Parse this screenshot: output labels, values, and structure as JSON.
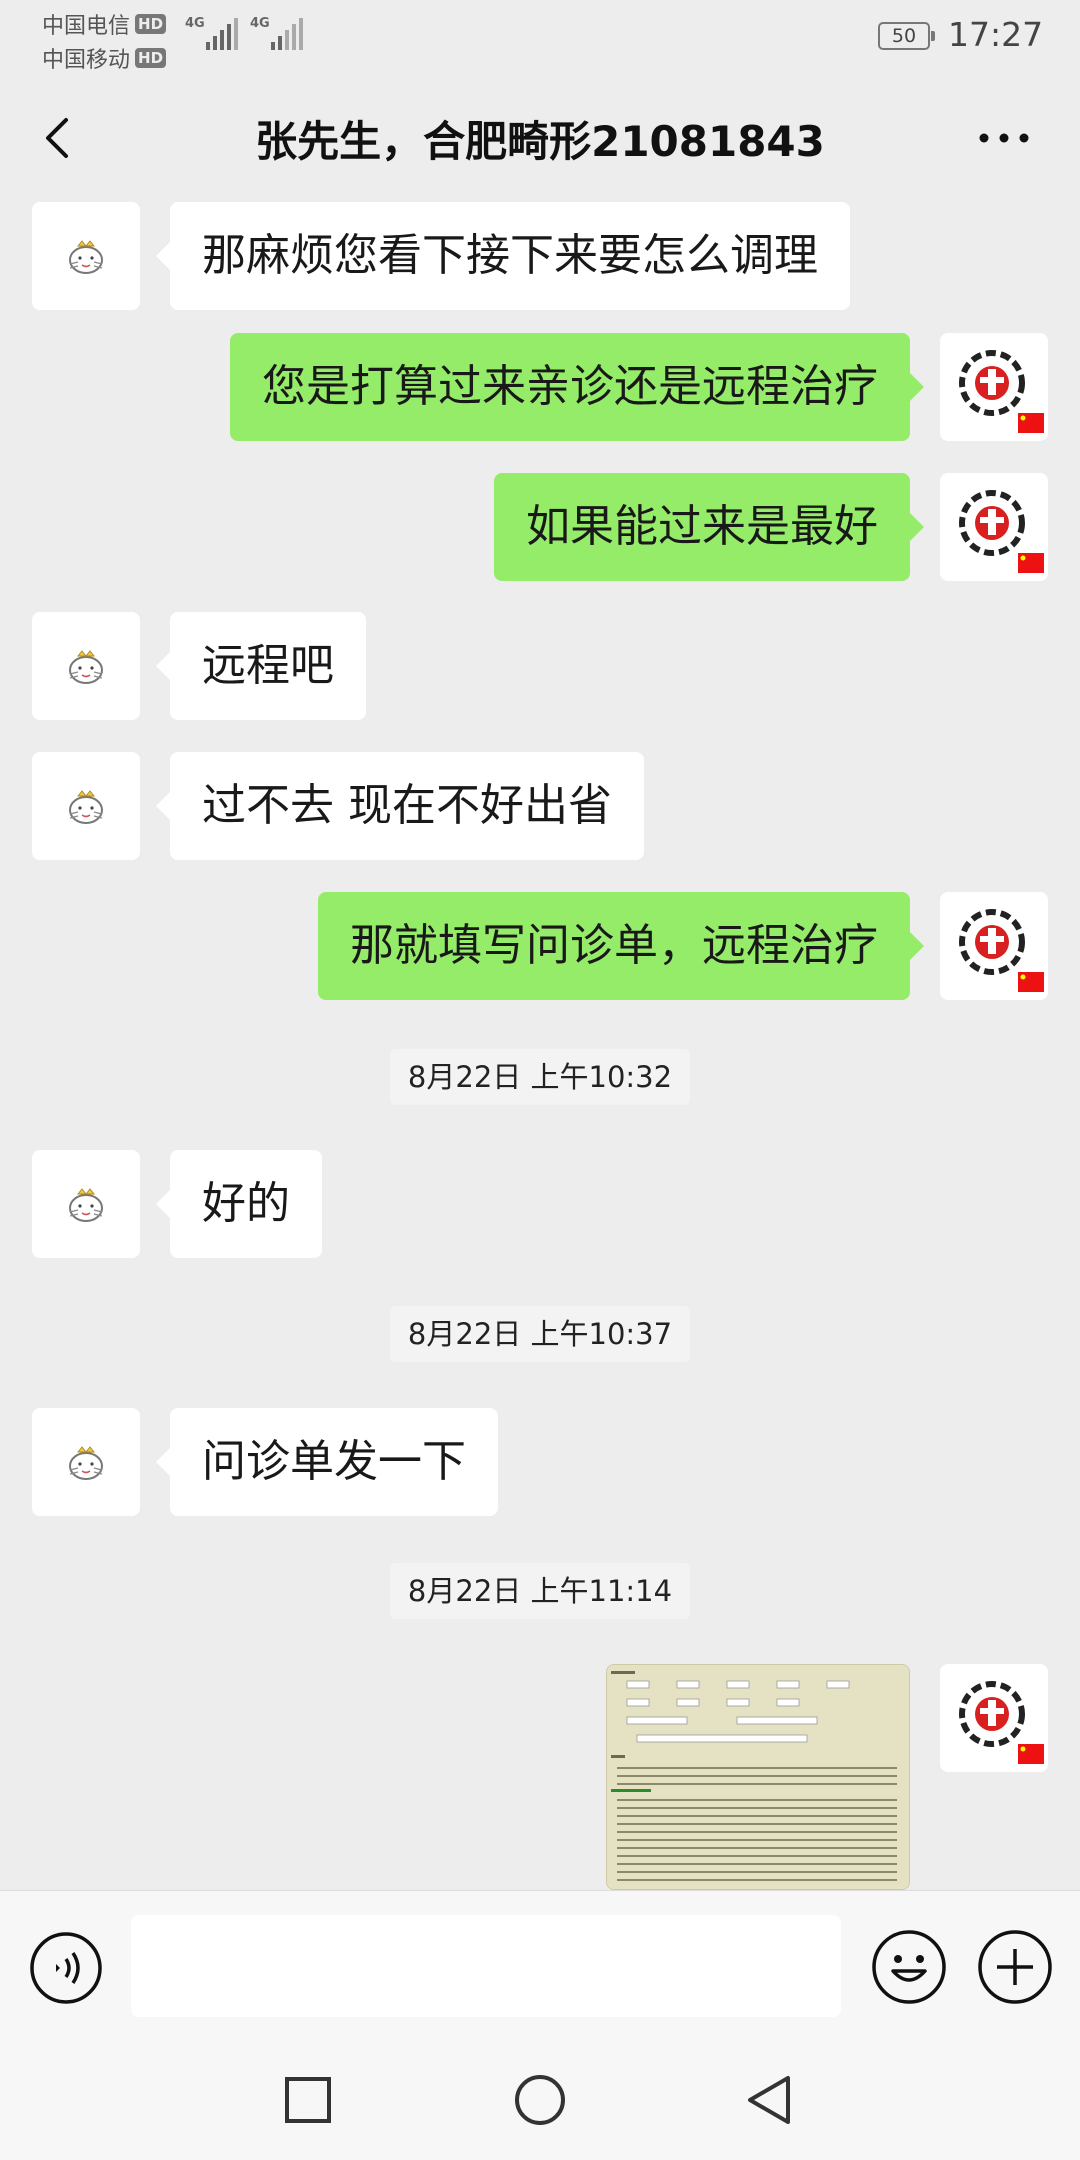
{
  "status_bar": {
    "carrier_1": "中国电信",
    "carrier_2": "中国移动",
    "hd_badge": "HD",
    "network_1": "4G",
    "network_2": "4G",
    "battery": "50",
    "time": "17:27"
  },
  "header": {
    "title": "张先生，合肥畸形21081843",
    "back_icon": "chevron-left-icon",
    "more_icon": "more-dots-icon"
  },
  "messages": [
    {
      "side": "left",
      "text": "那麻烦您看下接下来要怎么调理"
    },
    {
      "side": "right",
      "text": "您是打算过来亲诊还是远程治疗"
    },
    {
      "side": "right",
      "text": "如果能过来是最好"
    },
    {
      "side": "left",
      "text": "远程吧"
    },
    {
      "side": "left",
      "text": "过不去 现在不好出省"
    },
    {
      "side": "right",
      "text": "那就填写问诊单，远程治疗"
    },
    {
      "side": "left",
      "text": "好的"
    },
    {
      "side": "left",
      "text": "问诊单发一下"
    }
  ],
  "timestamps": [
    "8月22日 上午10:32",
    "8月22日 上午10:37",
    "8月22日 上午11:14"
  ],
  "image_message": {
    "side": "right",
    "icon": "form-image-thumbnail"
  },
  "input_bar": {
    "voice_icon": "voice-icon",
    "input_value": "",
    "emoji_icon": "emoji-icon",
    "plus_icon": "plus-icon"
  },
  "system_nav": {
    "icons": [
      "recent-apps-icon",
      "home-icon",
      "back-icon"
    ]
  },
  "colors": {
    "background": "#ededed",
    "bubble_self": "#95ec69",
    "bubble_other": "#ffffff"
  }
}
